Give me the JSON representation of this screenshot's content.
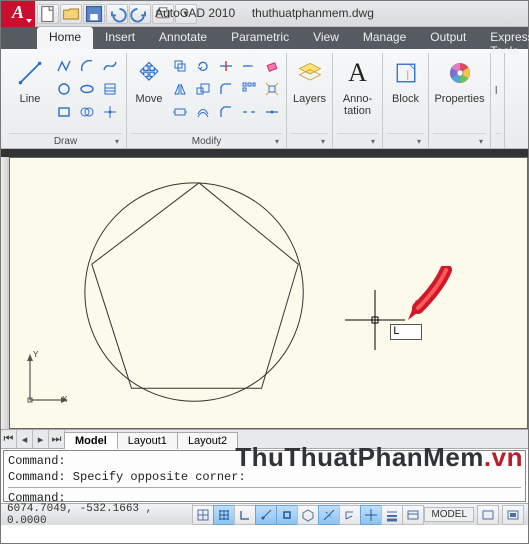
{
  "title": {
    "app": "AutoCAD 2010",
    "file": "thuthuatphanmem.dwg"
  },
  "app_menu_letter": "A",
  "ribbon_tabs": [
    "Home",
    "Insert",
    "Annotate",
    "Parametric",
    "View",
    "Manage",
    "Output",
    "Express Tools"
  ],
  "ribbon_active_tab": "Home",
  "panels": {
    "draw": {
      "title": "Draw",
      "big_label": "Line"
    },
    "modify": {
      "title": "Modify",
      "big_label": "Move"
    },
    "layers": {
      "title": "Layers"
    },
    "annotation": {
      "title": "Anno-\ntation"
    },
    "block": {
      "title": "Block"
    },
    "properties": {
      "title": "Properties"
    }
  },
  "canvas": {
    "dyn_input_value": "L",
    "ucs": {
      "x": "X",
      "y": "Y"
    }
  },
  "layout_tabs": [
    "Model",
    "Layout1",
    "Layout2"
  ],
  "layout_active": "Model",
  "command_lines": [
    "Command:",
    "Command: Specify opposite corner:",
    "Command:"
  ],
  "status": {
    "coords": "6074.7049, -532.1663 , 0.0000",
    "model_label": "MODEL"
  },
  "watermark": {
    "a": "ThuThuatPhanMem",
    "b": ".vn"
  }
}
